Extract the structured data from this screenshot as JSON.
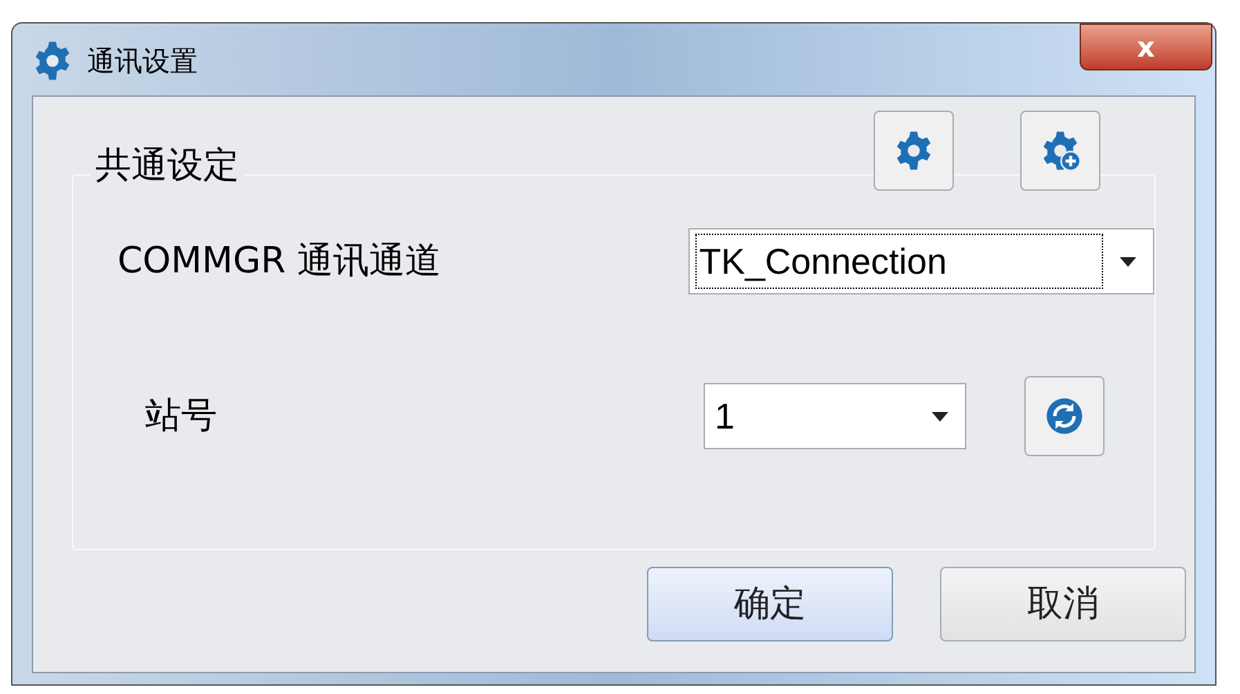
{
  "window": {
    "title": "通讯设置",
    "close": "x"
  },
  "toolbar": [
    {
      "kind": "gear"
    },
    {
      "kind": "gear-add"
    }
  ],
  "group": {
    "title": "共通设定",
    "fields": [
      {
        "label": "COMMGR 通讯通道",
        "value": "TK_Connection",
        "focused": true,
        "refresh": false
      },
      {
        "label": "站号",
        "value": "1",
        "focused": false,
        "refresh": true
      }
    ]
  },
  "buttons": [
    {
      "label": "确定",
      "default": true
    },
    {
      "label": "取消",
      "default": false
    }
  ]
}
